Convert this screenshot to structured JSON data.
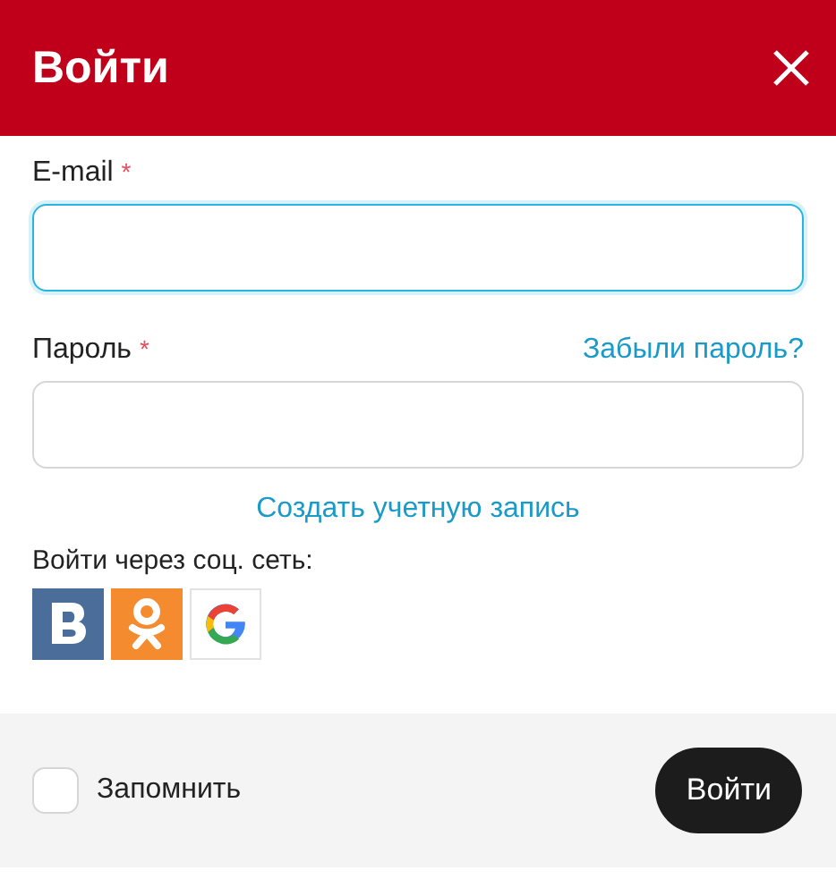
{
  "dialog": {
    "title": "Войти"
  },
  "fields": [
    {
      "label": "E-mail",
      "required_mark": "*",
      "focused": true
    },
    {
      "label": "Пароль",
      "required_mark": "*",
      "focused": false,
      "link": "Забыли пароль?"
    }
  ],
  "create_account_link": "Создать учетную запись",
  "social": {
    "label": "Войти через соц. сеть:",
    "providers": [
      {
        "kind": "vk"
      },
      {
        "kind": "ok"
      },
      {
        "kind": "google"
      }
    ]
  },
  "footer": {
    "remember": {
      "label": "Запомнить",
      "checked": false
    },
    "submit": "Войти"
  }
}
